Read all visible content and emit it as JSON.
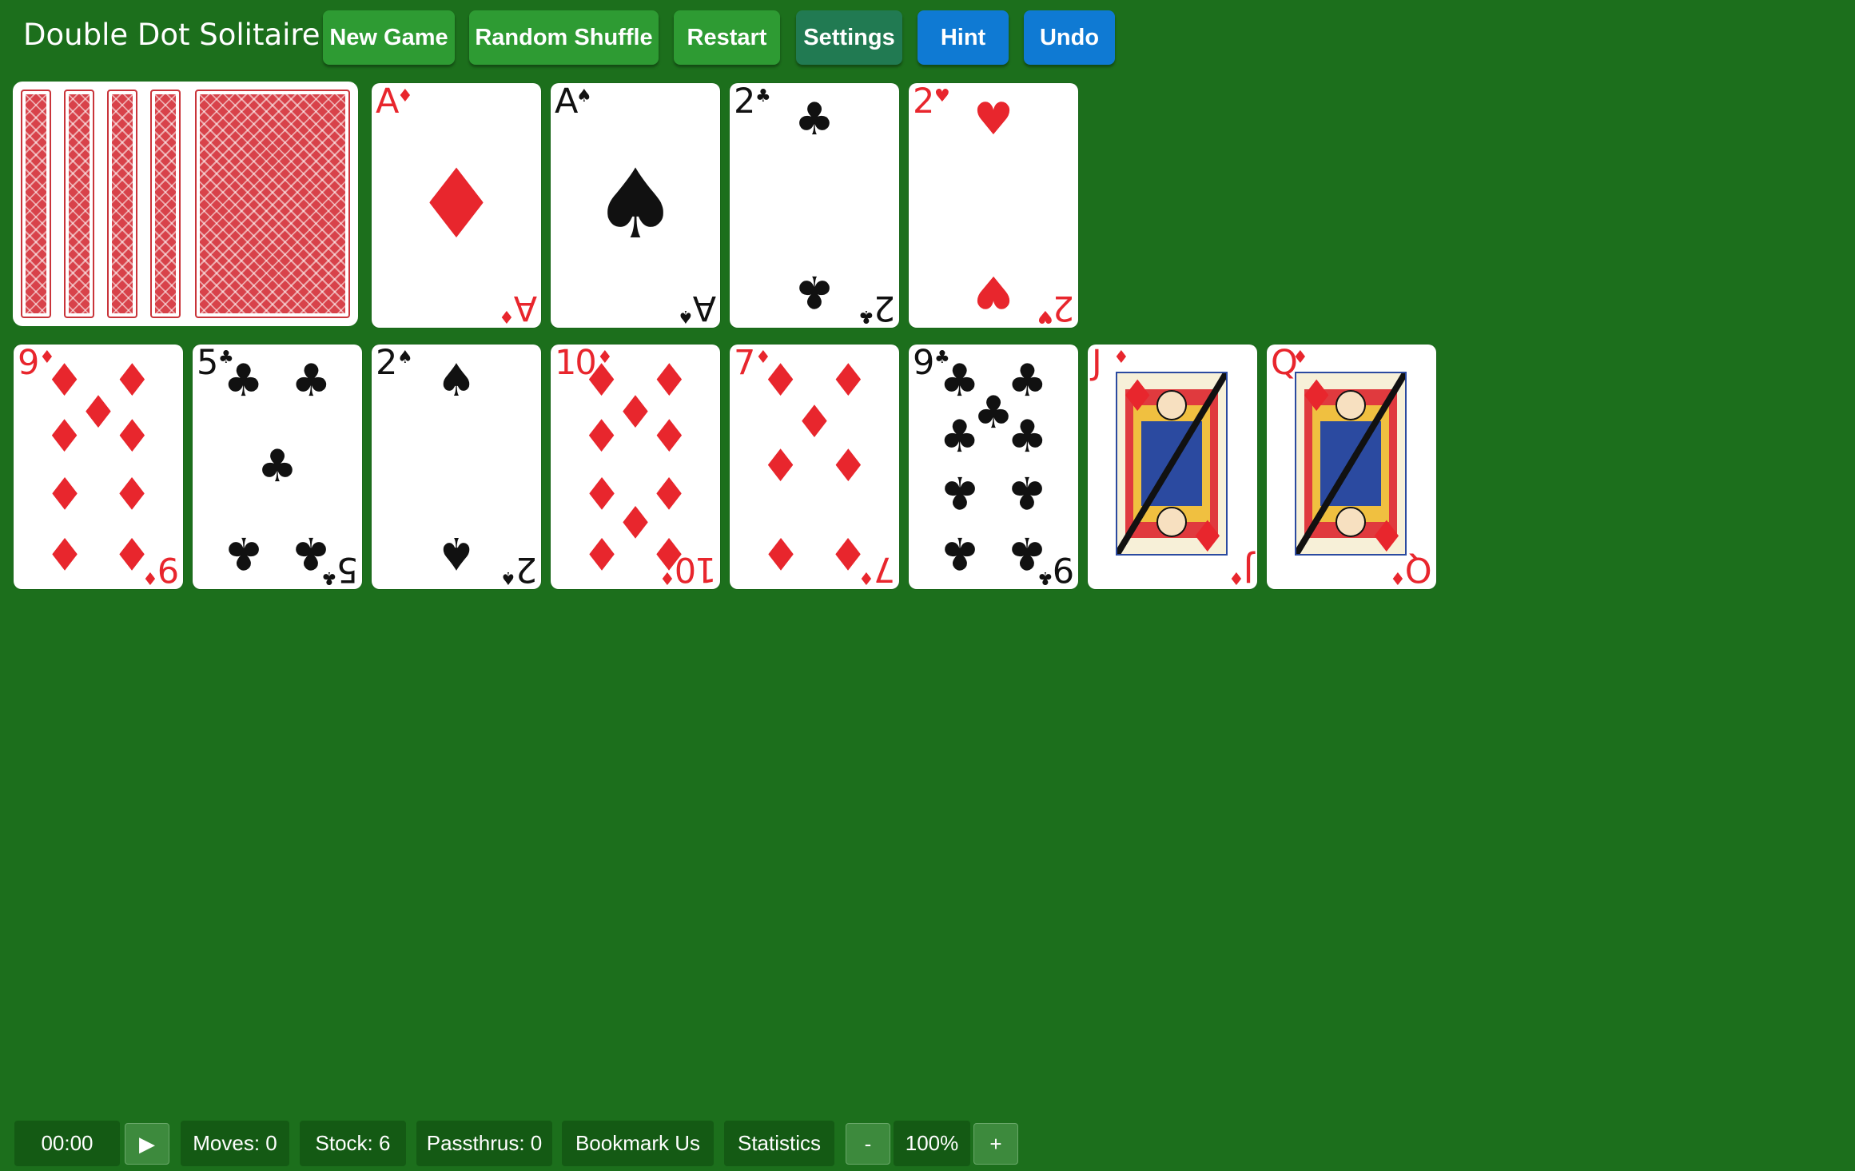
{
  "app": {
    "title": "Double Dot Solitaire"
  },
  "toolbar": {
    "new_game": "New Game",
    "random_shuffle": "Random Shuffle",
    "restart": "Restart",
    "settings": "Settings",
    "hint": "Hint",
    "undo": "Undo"
  },
  "foundations": [
    {
      "rank": "A",
      "suit": "♦",
      "color": "red"
    },
    {
      "rank": "A",
      "suit": "♠",
      "color": "black"
    },
    {
      "rank": "2",
      "suit": "♣",
      "color": "black"
    },
    {
      "rank": "2",
      "suit": "♥",
      "color": "red"
    }
  ],
  "tableau": [
    {
      "rank": "9",
      "suit": "♦",
      "color": "red"
    },
    {
      "rank": "5",
      "suit": "♣",
      "color": "black"
    },
    {
      "rank": "2",
      "suit": "♠",
      "color": "black"
    },
    {
      "rank": "10",
      "suit": "♦",
      "color": "red"
    },
    {
      "rank": "7",
      "suit": "♦",
      "color": "red"
    },
    {
      "rank": "9",
      "suit": "♣",
      "color": "black"
    },
    {
      "rank": "J",
      "suit": "♦",
      "color": "red"
    },
    {
      "rank": "Q",
      "suit": "♦",
      "color": "red"
    }
  ],
  "status": {
    "timer": "00:00",
    "play_icon": "▶",
    "moves": "Moves: 0",
    "stock": "Stock: 6",
    "passthrus": "Passthrus: 0",
    "bookmark": "Bookmark Us",
    "statistics": "Statistics",
    "zoom_out": "-",
    "zoom": "100%",
    "zoom_in": "+"
  },
  "colors": {
    "felt": "#1c6f1c",
    "red_suit": "#e8262d",
    "button_green": "#2e9b33",
    "button_blue": "#0f7ad3"
  }
}
